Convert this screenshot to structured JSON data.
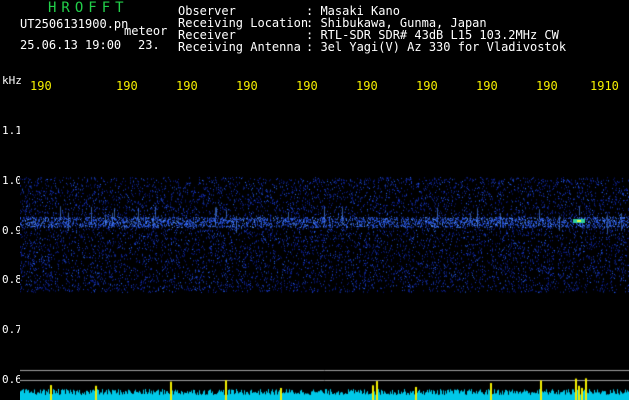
{
  "header": {
    "app_title": "HROFFT",
    "filename": "UT2506131900.pn",
    "mode": "meteor",
    "datetime": "25.06.13 19:00",
    "duration": "23."
  },
  "info": [
    {
      "label": "Observer",
      "value": ": Masaki Kano"
    },
    {
      "label": "Receiving Location",
      "value": ": Shibukawa, Gunma, Japan"
    },
    {
      "label": "Receiver",
      "value": ": RTL-SDR SDR# 43dB L15 103.2MHz CW"
    },
    {
      "label": "Receiving Antenna",
      "value": ": 3el Yagi(V) Az 330 for Vladivostok"
    }
  ],
  "spectrogram": {
    "y_unit": "kHz",
    "y_ticks": [
      "1.1",
      "1.0",
      "0.9",
      "0.8",
      "0.7",
      "0.6"
    ],
    "y_tick_values": [
      1.1,
      1.0,
      0.9,
      0.8,
      0.7,
      0.6
    ],
    "x_ticks": [
      "190",
      "190",
      "190",
      "190",
      "190",
      "190",
      "190",
      "190",
      "190",
      "1910"
    ],
    "colors": {
      "axis_label": "#f5f000",
      "grid": "#a0a0a0",
      "band_low": "#0a1a8a",
      "band_high": "#2a6cff",
      "echo": "#30d0a0",
      "noise_floor": "#00c8e8",
      "noise_peak": "#f5f000"
    }
  }
}
